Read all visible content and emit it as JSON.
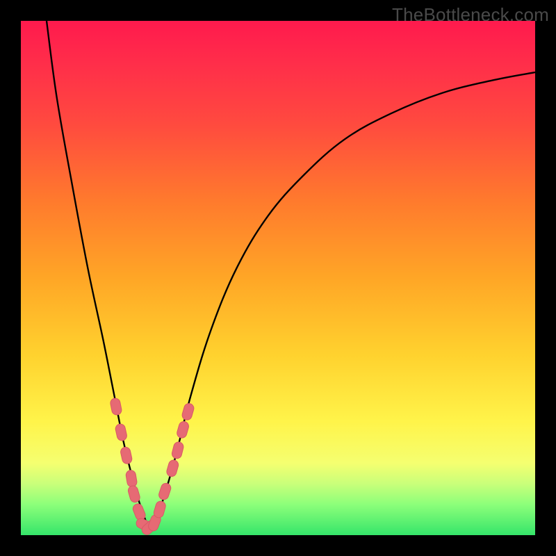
{
  "watermark": {
    "text": "TheBottleneck.com"
  },
  "colors": {
    "curve_stroke": "#000000",
    "marker_fill": "#e66a74",
    "marker_stroke": "#d85a65"
  },
  "chart_data": {
    "type": "line",
    "title": "",
    "xlabel": "",
    "ylabel": "",
    "xlim": [
      0,
      100
    ],
    "ylim": [
      0,
      100
    ],
    "series": [
      {
        "name": "bottleneck-curve",
        "x": [
          5,
          7,
          10,
          13,
          16,
          18,
          20,
          22,
          23.5,
          25,
          27,
          30,
          33,
          37,
          42,
          48,
          55,
          63,
          72,
          82,
          92,
          100
        ],
        "y": [
          100,
          85,
          68,
          52,
          38,
          28,
          18,
          10,
          5,
          2,
          5,
          15,
          27,
          40,
          52,
          62,
          70,
          77,
          82,
          86,
          88.5,
          90
        ]
      }
    ],
    "markers": {
      "name": "highlighted-points",
      "x": [
        18.5,
        19.5,
        20.5,
        21.5,
        22.0,
        23.0,
        24.0,
        25.0,
        26.0,
        27.0,
        28.0,
        29.5,
        30.5,
        31.5,
        32.5
      ],
      "y": [
        25.0,
        20.0,
        15.5,
        11.0,
        8.0,
        4.5,
        2.0,
        1.5,
        2.4,
        5.0,
        8.5,
        13.0,
        16.5,
        20.5,
        24.0
      ]
    }
  }
}
